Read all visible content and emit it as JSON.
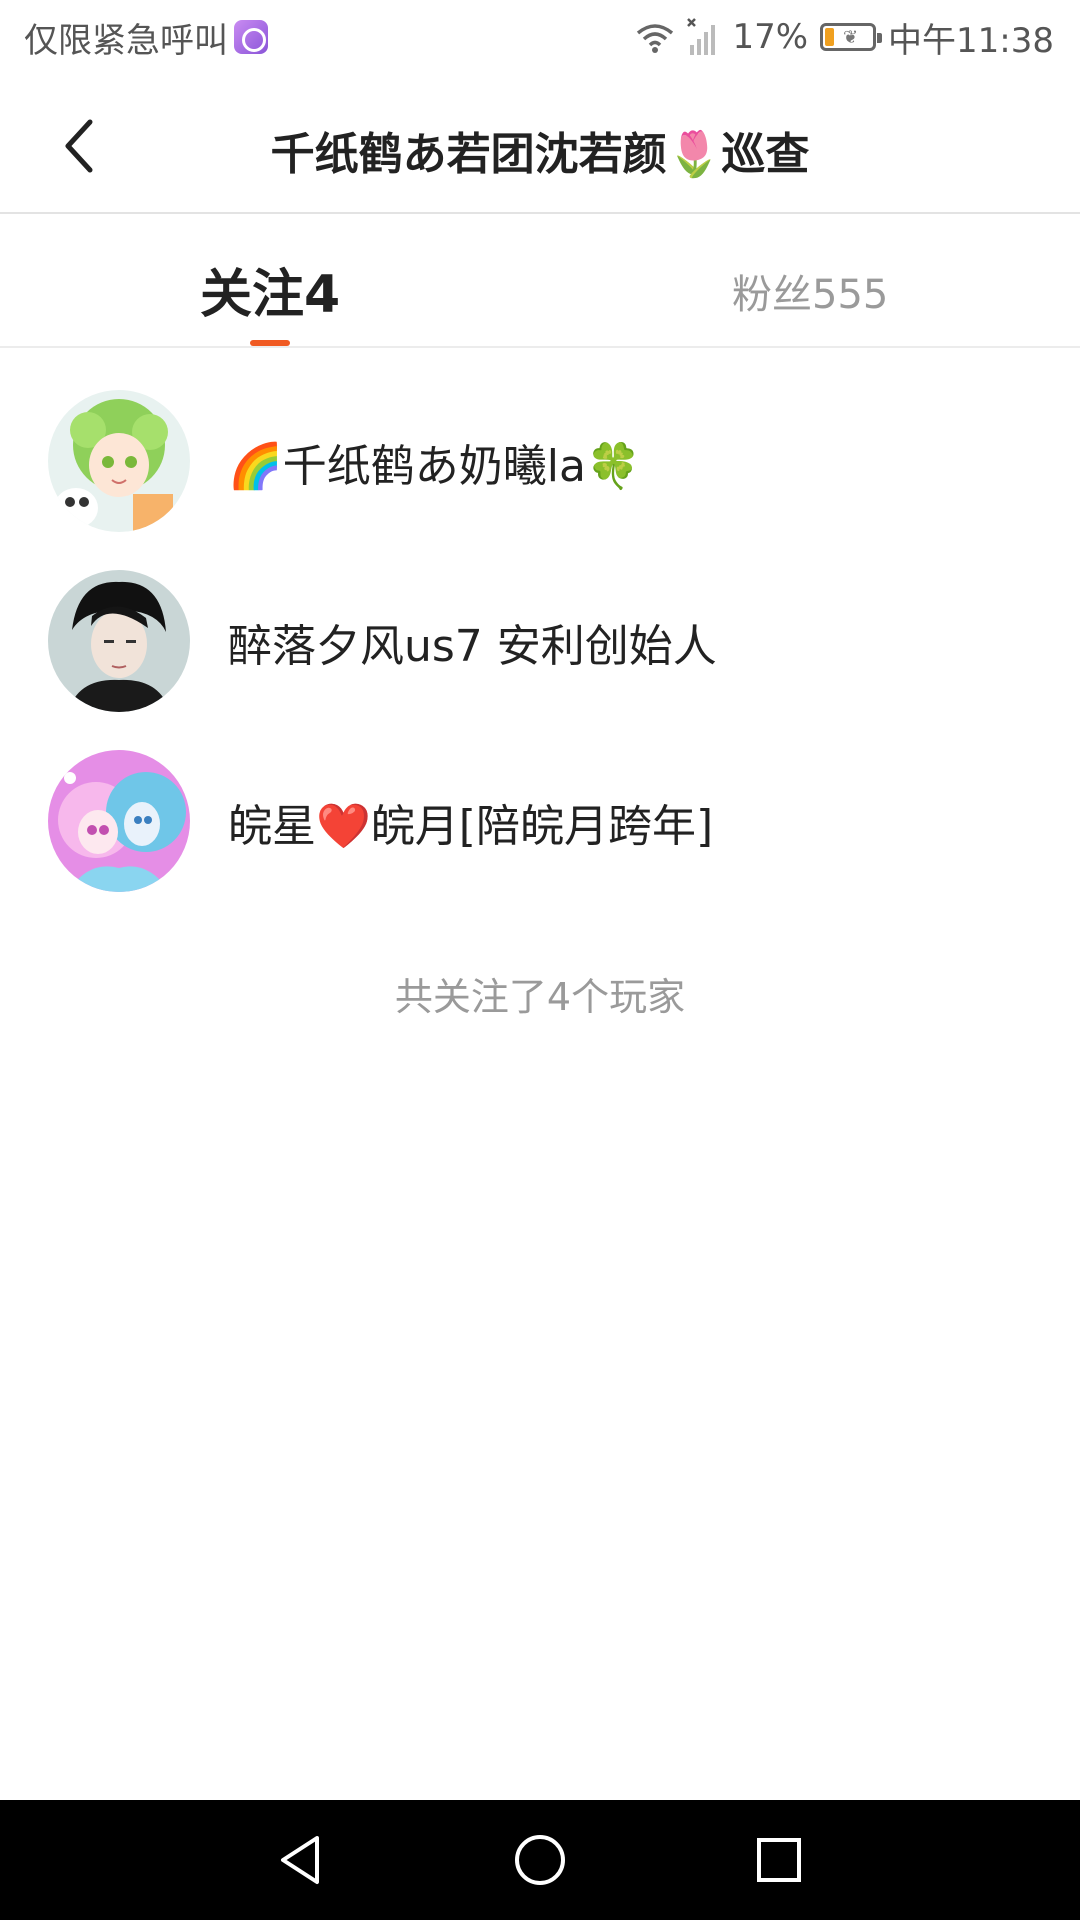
{
  "status_bar": {
    "carrier": "仅限紧急呼叫",
    "battery_percent": "17%",
    "battery_level": 0.17,
    "time": "中午11:38",
    "icons": [
      "app-badge-icon",
      "wifi-icon",
      "signal-icon",
      "battery-icon"
    ]
  },
  "header": {
    "title": "千纸鹤あ若团沈若颜🌷巡查",
    "back_icon": "chevron-left-icon"
  },
  "tabs": [
    {
      "label": "关注4",
      "active": true
    },
    {
      "label": "粉丝555",
      "active": false
    }
  ],
  "accent_color": "#f05a22",
  "following_list": [
    {
      "name": "🌈千纸鹤あ奶曦la🍀",
      "avatar": "avatar-green-hair"
    },
    {
      "name": "醉落夕风us7   安利创始人",
      "avatar": "avatar-dark-hair"
    },
    {
      "name": "皖星❤️皖月[陪皖月跨年]",
      "avatar": "avatar-pink-blue"
    }
  ],
  "footer_note": "共关注了4个玩家",
  "nav_bar": {
    "icons": [
      "back-triangle-icon",
      "home-circle-icon",
      "recents-square-icon"
    ]
  }
}
